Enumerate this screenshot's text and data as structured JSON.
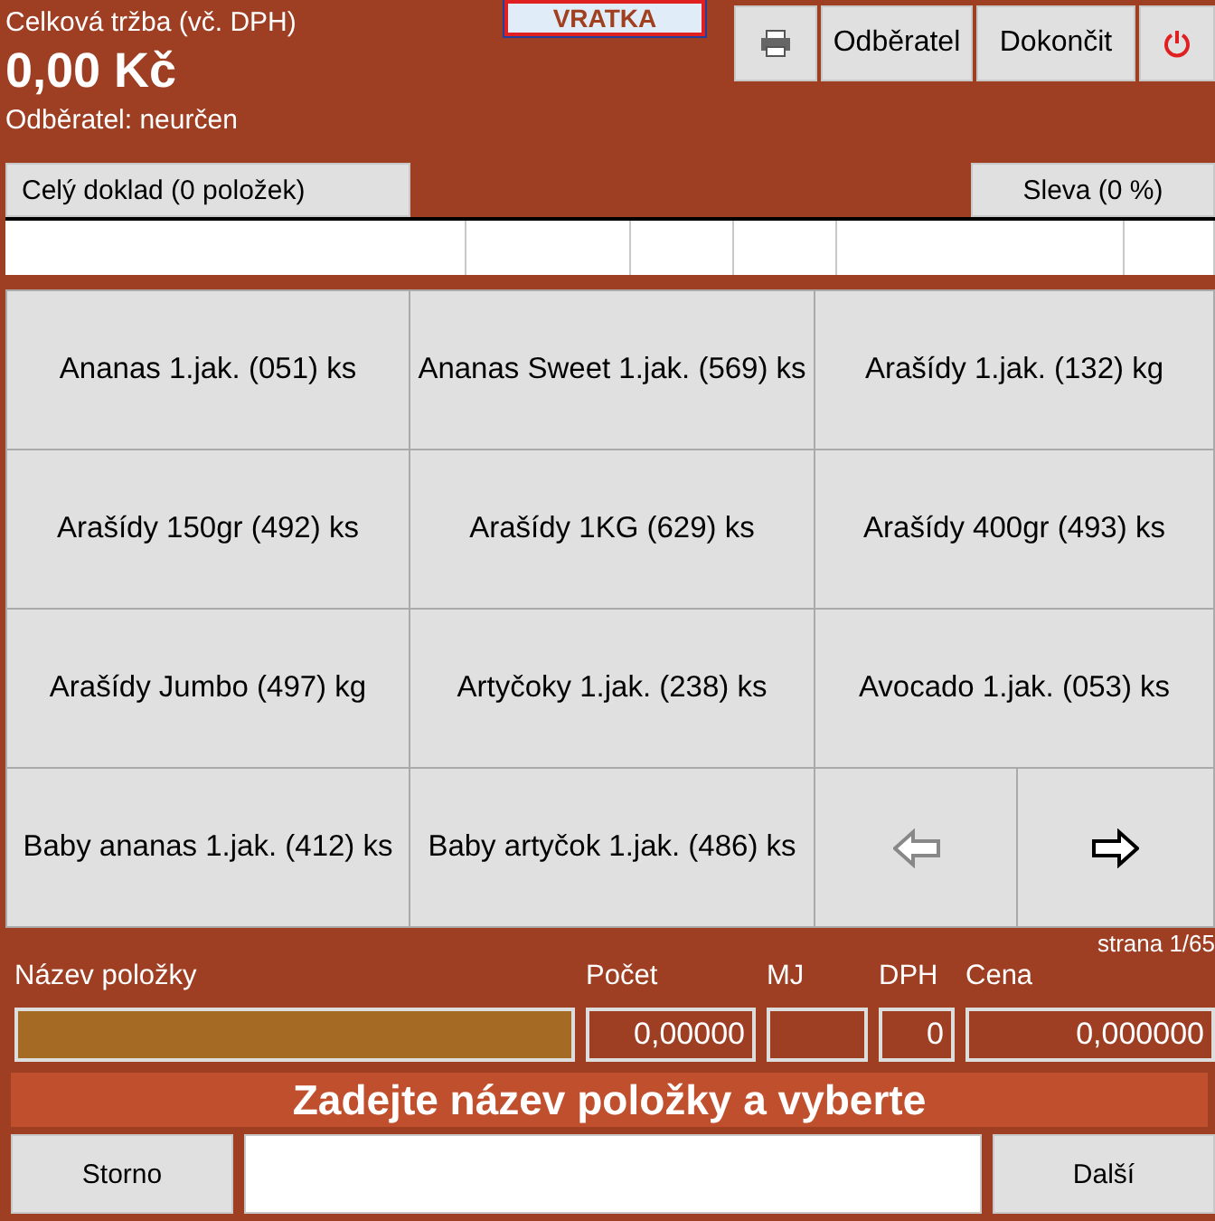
{
  "header": {
    "title": "Celková tržba (vč. DPH)",
    "total": "0,00 Kč",
    "customer": "Odběratel: neurčen",
    "mode": "VRATKA"
  },
  "toolbar": [
    {
      "kind": "print"
    },
    {
      "kind": "text",
      "label": "Odběratel"
    },
    {
      "kind": "text",
      "label": "Dokončit"
    },
    {
      "kind": "power"
    }
  ],
  "tabs": {
    "document": "Celý doklad (0 položek)",
    "discount": "Sleva (0 %)"
  },
  "products": [
    "Ananas 1.jak. (051) ks",
    "Ananas Sweet 1.jak. (569) ks",
    "Arašídy 1.jak. (132) kg",
    "Arašídy 150gr (492) ks",
    "Arašídy 1KG (629) ks",
    "Arašídy 400gr (493) ks",
    "Arašídy Jumbo (497) kg",
    "Artyčoky 1.jak. (238) ks",
    "Avocado 1.jak. (053) ks",
    "Baby ananas 1.jak. (412) ks",
    "Baby artyčok 1.jak. (486) ks"
  ],
  "pager": {
    "prev_disabled": true,
    "next_disabled": false,
    "page": "strana 1/65"
  },
  "fields": [
    {
      "label": "Název položky",
      "kind": "name"
    },
    {
      "label": "Počet",
      "value": "0,00000",
      "kind": "count"
    },
    {
      "label": "MJ",
      "kind": "unit"
    },
    {
      "label": "DPH",
      "value": "0",
      "kind": "vat"
    },
    {
      "label": "Cena",
      "value": "0,000000",
      "kind": "price"
    }
  ],
  "prompt": "Zadejte název položky a vyberte",
  "actions": {
    "cancel": "Storno",
    "next": "Další"
  }
}
